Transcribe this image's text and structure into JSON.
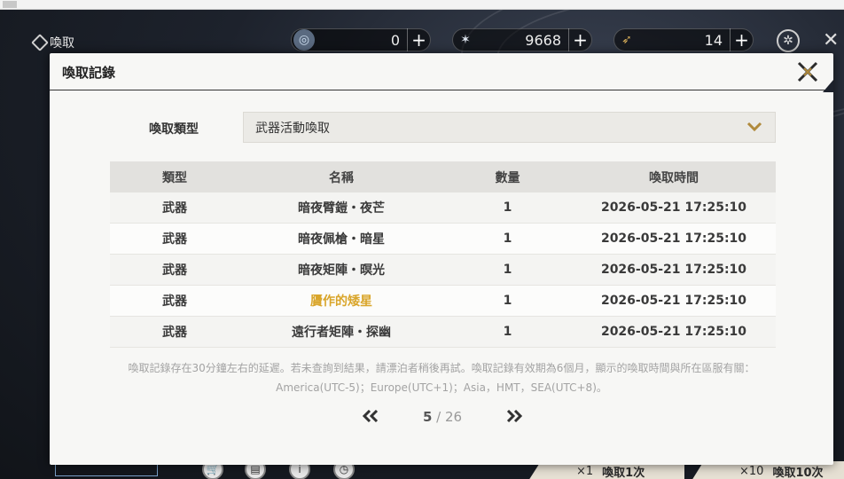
{
  "window": {
    "title_icon": "app-icon"
  },
  "hud": {
    "title": "喚取",
    "currencies": [
      {
        "icon": "crystal-orb-icon",
        "value": "0"
      },
      {
        "icon": "star-shard-icon",
        "value": "9668"
      },
      {
        "icon": "feather-token-icon",
        "value": "14"
      }
    ],
    "plus": "+"
  },
  "bottom": {
    "pull_one": {
      "count": "×1",
      "label": "喚取1次"
    },
    "pull_ten": {
      "count": "×10",
      "label": "喚取10次"
    }
  },
  "dialog": {
    "title": "喚取記錄",
    "filter": {
      "label": "喚取類型",
      "selected": "武器活動喚取"
    },
    "columns": [
      "類型",
      "名稱",
      "數量",
      "喚取時間"
    ],
    "rows": [
      {
        "type": "武器",
        "name": "暗夜臂鎧・夜芒",
        "qty": "1",
        "time": "2026-05-21 17:25:10",
        "highlight": false
      },
      {
        "type": "武器",
        "name": "暗夜佩槍・暗星",
        "qty": "1",
        "time": "2026-05-21 17:25:10",
        "highlight": false
      },
      {
        "type": "武器",
        "name": "暗夜矩陣・暝光",
        "qty": "1",
        "time": "2026-05-21 17:25:10",
        "highlight": false
      },
      {
        "type": "武器",
        "name": "贗作的矮星",
        "qty": "1",
        "time": "2026-05-21 17:25:10",
        "highlight": true
      },
      {
        "type": "武器",
        "name": "遠行者矩陣・探幽",
        "qty": "1",
        "time": "2026-05-21 17:25:10",
        "highlight": false
      }
    ],
    "notice_line1": "喚取記錄存在30分鐘左右的延遲。若未查詢到結果，請漂泊者稍後再試。喚取記錄有效期為6個月，顯示的喚取時間與所在區服有關：",
    "notice_line2": "America(UTC-5)；Europe(UTC+1)；Asia，HMT，SEA(UTC+8)。",
    "pager": {
      "current": "5",
      "separator": " / ",
      "total": "26",
      "prev": "«",
      "next": "»"
    }
  },
  "colors": {
    "accent_gold": "#d9a52a",
    "chevron_gold": "#b08a3c"
  }
}
